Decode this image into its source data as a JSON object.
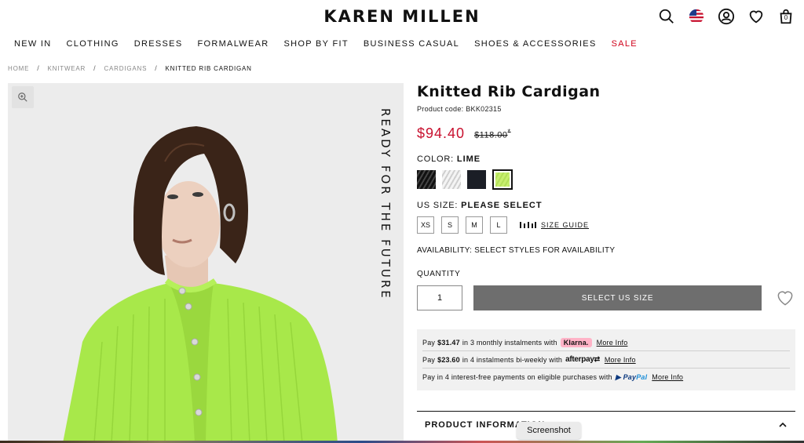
{
  "header": {
    "logo": "KAREN MILLEN",
    "cart_count": "0",
    "icons": [
      "search-icon",
      "us-flag-icon",
      "account-icon",
      "wishlist-icon",
      "bag-icon"
    ]
  },
  "nav": {
    "items": [
      "NEW IN",
      "CLOTHING",
      "DRESSES",
      "FORMALWEAR",
      "SHOP BY FIT",
      "BUSINESS CASUAL",
      "SHOES & ACCESSORIES",
      "SALE"
    ]
  },
  "breadcrumb": {
    "items": [
      "HOME",
      "KNITWEAR",
      "CARDIGANS",
      "KNITTED RIB CARDIGAN"
    ]
  },
  "hero": {
    "vertical_text": "READY FOR THE FUTURE",
    "colors": {
      "background": "#ececec",
      "cardigan": "#a8e84a",
      "hair": "#3a2418"
    }
  },
  "product": {
    "title": "Knitted Rib Cardigan",
    "code_label": "Product code: BKK02315",
    "price_now": "$94.40",
    "price_was": "$118.00",
    "price_mark": "*",
    "color_label": "COLOR:",
    "color_value": "LIME",
    "swatches": [
      {
        "name": "black-stripe",
        "color": "#222222"
      },
      {
        "name": "white-stripe",
        "color": "#e4e4e4"
      },
      {
        "name": "navy",
        "color": "#1b1e26"
      },
      {
        "name": "lime",
        "color": "#c7ef6e"
      }
    ],
    "size_label": "US SIZE:",
    "size_value": "PLEASE SELECT",
    "sizes": [
      "XS",
      "S",
      "M",
      "L"
    ],
    "size_guide": "SIZE GUIDE",
    "availability": "AVAILABILITY:  SELECT STYLES FOR AVAILABILITY",
    "quantity_label": "QUANTITY",
    "quantity_value": "1",
    "add_button": "SELECT US SIZE"
  },
  "payments": {
    "klarna": {
      "pre": "Pay",
      "amount": "$31.47",
      "post": "in 3 monthly instalments with",
      "brand": "Klarna.",
      "link": "More Info"
    },
    "afterpay": {
      "pre": "Pay",
      "amount": "$23.60",
      "post": "in 4 instalments bi-weekly with",
      "brand": "afterpay",
      "link": "More Info"
    },
    "paypal": {
      "text": "Pay in 4 interest-free payments on eligible purchases with",
      "brand_a": "Pay",
      "brand_b": "Pal",
      "link": "More Info"
    }
  },
  "accordion": {
    "label": "PRODUCT INFORMATION"
  },
  "tooltip": "Screenshot",
  "colors": {
    "sale": "#d0021b",
    "price": "#c8102e",
    "button": "#6e6e6e"
  }
}
